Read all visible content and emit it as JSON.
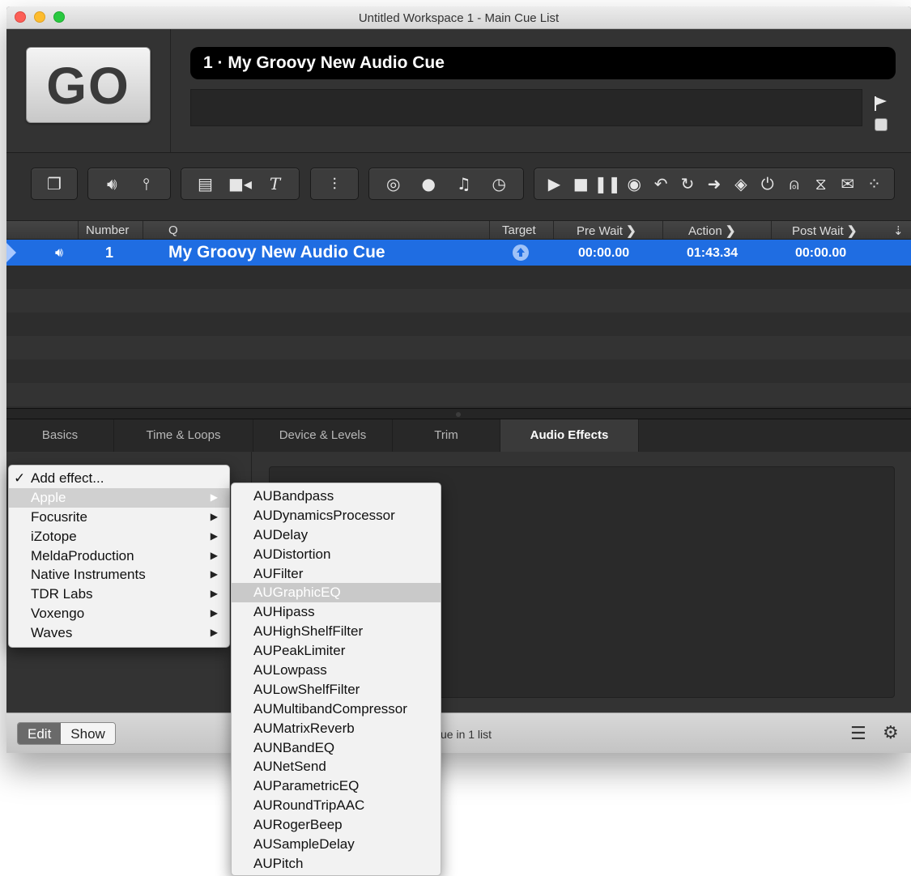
{
  "window": {
    "title": "Untitled Workspace 1 - Main Cue List"
  },
  "go": {
    "label": "GO"
  },
  "cue_title": "1 · My Groovy New Audio Cue",
  "columns": {
    "number": "Number",
    "q": "Q",
    "target": "Target",
    "pre_wait": "Pre Wait",
    "action": "Action",
    "post_wait": "Post Wait"
  },
  "cue": {
    "number": "1",
    "name": "My Groovy New Audio Cue",
    "pre_wait": "00:00.00",
    "action": "01:43.34",
    "post_wait": "00:00.00"
  },
  "tabs": [
    "Basics",
    "Time & Loops",
    "Device & Levels",
    "Trim",
    "Audio Effects"
  ],
  "active_tab": "Audio Effects",
  "add_effect_menu": {
    "header": "Add effect...",
    "items": [
      "Apple",
      "Focusrite",
      "iZotope",
      "MeldaProduction",
      "Native Instruments",
      "TDR Labs",
      "Voxengo",
      "Waves"
    ],
    "highlighted": "Apple"
  },
  "apple_submenu": {
    "items": [
      "AUBandpass",
      "AUDynamicsProcessor",
      "AUDelay",
      "AUDistortion",
      "AUFilter",
      "AUGraphicEQ",
      "AUHipass",
      "AUHighShelfFilter",
      "AUPeakLimiter",
      "AULowpass",
      "AULowShelfFilter",
      "AUMultibandCompressor",
      "AUMatrixReverb",
      "AUNBandEQ",
      "AUNetSend",
      "AUParametricEQ",
      "AURoundTripAAC",
      "AURogerBeep",
      "AUSampleDelay",
      "AUPitch"
    ],
    "highlighted": "AUGraphicEQ"
  },
  "statusbar": {
    "edit": "Edit",
    "show": "Show",
    "status": "ue in 1 list"
  },
  "colors": {
    "selection": "#1f6de2",
    "background": "#2c2c2c"
  },
  "icons": {
    "group1": [
      "group-icon"
    ],
    "group2": [
      "speaker-icon",
      "mic-icon"
    ],
    "group3": [
      "film-icon",
      "camera-icon",
      "text-icon"
    ],
    "group4": [
      "fader-icon"
    ],
    "group5": [
      "target-icon",
      "midi-icon",
      "music-note-icon",
      "clock-icon"
    ],
    "group6": [
      "play-icon",
      "stop-icon",
      "pause-icon",
      "record-icon",
      "undo-icon",
      "reload-icon",
      "arrow-right-icon",
      "devamp-icon",
      "power-icon",
      "goto-icon",
      "hourglass-icon",
      "memo-icon",
      "script-icon"
    ]
  }
}
